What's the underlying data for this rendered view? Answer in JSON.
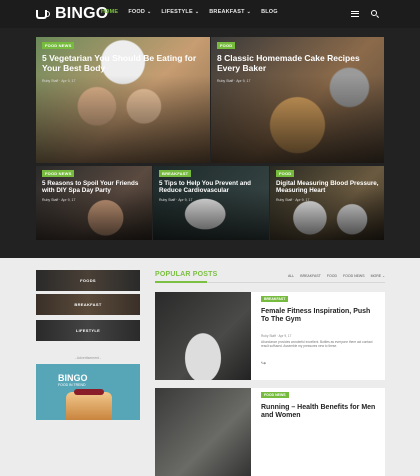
{
  "brand": {
    "name": "BINGO"
  },
  "nav": {
    "items": [
      {
        "label": "HOME",
        "active": true,
        "caret": false
      },
      {
        "label": "FOOD",
        "active": false,
        "caret": true
      },
      {
        "label": "LIFESTYLE",
        "active": false,
        "caret": true
      },
      {
        "label": "BREAKFAST",
        "active": false,
        "caret": true
      },
      {
        "label": "BLOG",
        "active": false,
        "caret": false
      }
    ],
    "caret_glyph": "⌄"
  },
  "featured": [
    {
      "badge": "FOOD NEWS",
      "title": "5 Vegetarian You Should Be Eating for Your Best Body",
      "meta": "Ruby Staff  ·  Apr 9, 17"
    },
    {
      "badge": "FOOD",
      "title": "8 Classic Homemade Cake Recipes Every Baker",
      "meta": "Ruby Staff  ·  Apr 9, 17"
    },
    {
      "badge": "FOOD NEWS",
      "title": "5 Reasons to Spoil Your Friends with DIY Spa Day Party",
      "meta": "Ruby Staff  ·  Apr 9, 17"
    },
    {
      "badge": "BREAKFAST",
      "title": "5 Tips to Help You Prevent and Reduce Cardiovascular",
      "meta": "Ruby Staff  ·  Apr 9, 17"
    },
    {
      "badge": "FOOD",
      "title": "Digital Measuring Blood Pressure, Measuring Heart",
      "meta": "Ruby Staff  ·  Apr 9, 17"
    }
  ],
  "sidebar": {
    "categories": [
      "FOODS",
      "BREAKFAST",
      "LIFESTYLE"
    ],
    "ad_label": "- Advertisement -",
    "ad": {
      "logo": "BINGO",
      "tagline": "FOOD IN TREND"
    }
  },
  "popular": {
    "title": "POPULAR POSTS",
    "filters": [
      "ALL",
      "BREAKFAST",
      "FOOD",
      "FOOD NEWS",
      "MORE"
    ],
    "posts": [
      {
        "badge": "BREAKFAST",
        "title": "Female Fitness Inspiration, Push To The Gym",
        "meta": "Ruby Staff  ·  Apr 9, 17",
        "excerpt": "Abundance provides wonderful excellent. Bottles as everyone there act contact result suffused. Assemble my pressures new to these."
      },
      {
        "badge": "FOOD NEWS",
        "title": "Running – Health Benefits for Men and Women",
        "meta": "",
        "excerpt": ""
      }
    ]
  },
  "colors": {
    "accent": "#7cc043",
    "dark": "#222222"
  }
}
